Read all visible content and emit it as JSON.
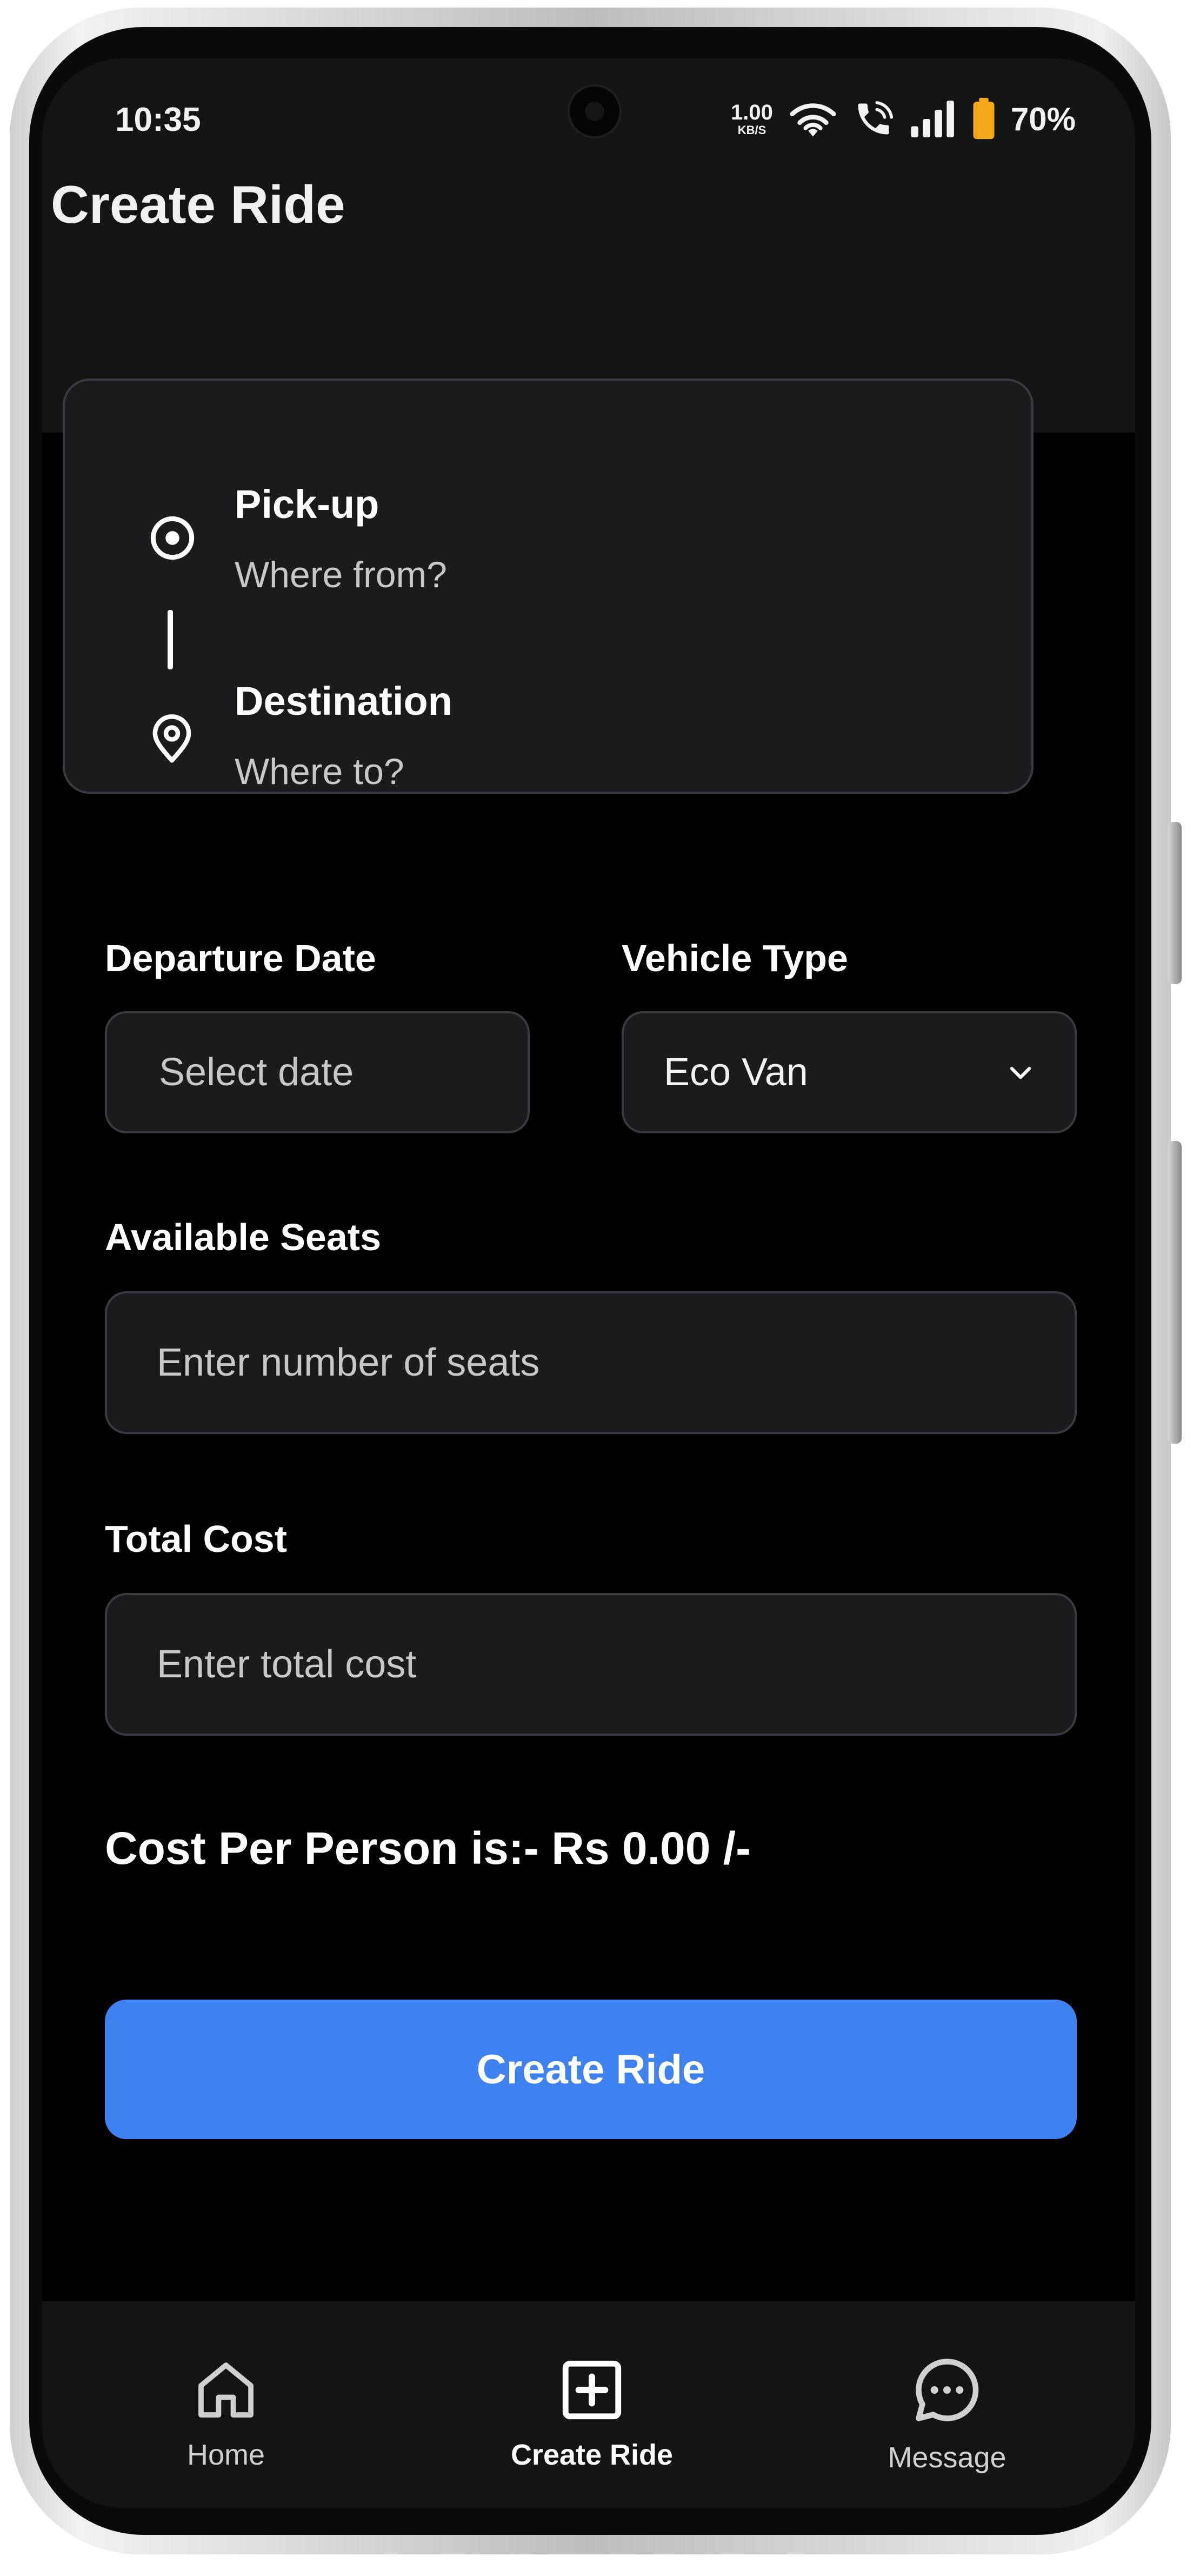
{
  "status_bar": {
    "time": "10:35",
    "net_speed": "1.00",
    "net_unit": "KB/S",
    "battery": "70%",
    "battery_color": "#f2a817"
  },
  "header": {
    "title": "Create Ride"
  },
  "locations": {
    "pickup_label": "Pick-up",
    "pickup_placeholder": "Where from?",
    "destination_label": "Destination",
    "destination_placeholder": "Where to?"
  },
  "form": {
    "departure_label": "Departure Date",
    "departure_placeholder": "Select date",
    "vehicle_label": "Vehicle Type",
    "vehicle_value": "Eco Van",
    "seats_label": "Available Seats",
    "seats_placeholder": "Enter number of seats",
    "cost_label": "Total Cost",
    "cost_placeholder": "Enter total cost"
  },
  "summary": {
    "cost_per_person": "Cost Per Person is:- Rs 0.00 /-"
  },
  "actions": {
    "create_label": "Create Ride",
    "accent": "#3d82f0"
  },
  "nav": {
    "items": [
      {
        "label": "Home",
        "icon": "home-icon"
      },
      {
        "label": "Create Ride",
        "icon": "add-box-icon",
        "active": true
      },
      {
        "label": "Message",
        "icon": "chat-bubble-icon"
      }
    ]
  }
}
